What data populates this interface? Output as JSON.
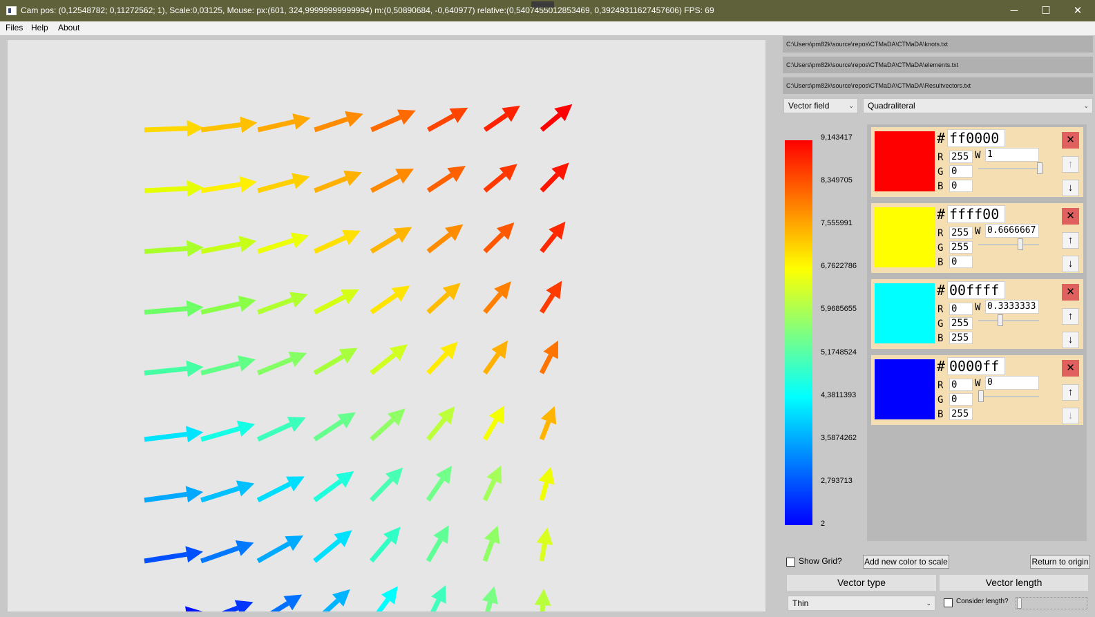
{
  "window": {
    "title": "Cam pos: (0,12548782; 0,11272562; 1), Scale:0,03125, Mouse: px:(601, 324,99999999999994) m:(0,50890684, -0,640977) relative:(0,5407455012853469, 0,39249311627457606) FPS: 69",
    "minimize_glyph": "─",
    "maximize_glyph": "☐",
    "close_glyph": "✕"
  },
  "menu": {
    "files": "Files",
    "help": "Help",
    "about": "About"
  },
  "paths": {
    "knots": "C:\\Users\\pm82k\\source\\repos\\CTMaDA\\CTMaDA\\knots.txt",
    "elements": "C:\\Users\\pm82k\\source\\repos\\CTMaDA\\CTMaDA\\elements.txt",
    "results": "C:\\Users\\pm82k\\source\\repos\\CTMaDA\\CTMaDA\\Resultvectors.txt"
  },
  "display_mode": {
    "selected": "Vector field"
  },
  "element_type": {
    "selected": "Quadraliteral"
  },
  "scale_ticks": [
    "9,143417",
    "8,349705",
    "7,555991",
    "6,7622786",
    "5,9685655",
    "5,1748524",
    "4,3811393",
    "3,5874262",
    "2,793713",
    "2"
  ],
  "color_entries": [
    {
      "hex": "ff0000",
      "color": "#ff0000",
      "r": "255",
      "g": "0",
      "b": "0",
      "w": "1",
      "w_value": 1.0,
      "up_enabled": false,
      "down_enabled": true
    },
    {
      "hex": "ffff00",
      "color": "#ffff00",
      "r": "255",
      "g": "255",
      "b": "0",
      "w": "0.6666667",
      "w_value": 0.6666667,
      "up_enabled": true,
      "down_enabled": true
    },
    {
      "hex": "00ffff",
      "color": "#00ffff",
      "r": "0",
      "g": "255",
      "b": "255",
      "w": "0.3333333",
      "w_value": 0.3333333,
      "up_enabled": true,
      "down_enabled": true
    },
    {
      "hex": "0000ff",
      "color": "#0000ff",
      "r": "0",
      "g": "0",
      "b": "255",
      "w": "0",
      "w_value": 0.0,
      "up_enabled": true,
      "down_enabled": false
    }
  ],
  "labels": {
    "hash": "#",
    "r": "R",
    "g": "G",
    "b": "B",
    "w": "W",
    "delete_glyph": "✕",
    "up_glyph": "↑",
    "down_glyph": "↓",
    "show_grid": "Show Grid?",
    "add_color": "Add new color to scale",
    "return_origin": "Return to origin",
    "vector_type_header": "Vector type",
    "vector_length_header": "Vector length",
    "consider_length": "Consider length?"
  },
  "vector_type": {
    "selected": "Thin"
  },
  "show_grid_checked": false,
  "consider_length_checked": false,
  "vector_length_slider": 0.0,
  "vector_field": {
    "rows": 9,
    "cols": 8,
    "colors": [
      [
        "#ffd800",
        "#ffc000",
        "#ffa800",
        "#ff8c00",
        "#ff6a00",
        "#ff4400",
        "#ff2200",
        "#ff0000"
      ],
      [
        "#e6ff00",
        "#fff000",
        "#ffd000",
        "#ffb000",
        "#ff8a00",
        "#ff6000",
        "#ff3800",
        "#ff1400"
      ],
      [
        "#a8ff2a",
        "#c8ff18",
        "#ecff08",
        "#ffe000",
        "#ffb400",
        "#ff8c00",
        "#ff5800",
        "#ff2800"
      ],
      [
        "#6cff66",
        "#8aff48",
        "#b0ff30",
        "#d4ff14",
        "#ffe400",
        "#ffbc00",
        "#ff8000",
        "#ff3c00"
      ],
      [
        "#44ffa4",
        "#62ff86",
        "#84ff64",
        "#a8ff3c",
        "#d0ff20",
        "#ffec00",
        "#ffb000",
        "#ff7400"
      ],
      [
        "#00e4ff",
        "#14ffe6",
        "#3cffbc",
        "#66ff8e",
        "#90ff66",
        "#bcff3a",
        "#f4ff00",
        "#ffb400"
      ],
      [
        "#00a8ff",
        "#00c0ff",
        "#00deff",
        "#20ffdc",
        "#48ffb4",
        "#72ff8a",
        "#a4ff5a",
        "#f0ff00"
      ],
      [
        "#0050ff",
        "#0078ff",
        "#00aaff",
        "#00e0ff",
        "#30ffc6",
        "#60ff96",
        "#90ff66",
        "#d8ff20"
      ],
      [
        "#0010ff",
        "#0034ff",
        "#0070ff",
        "#00b4ff",
        "#00ffff",
        "#40ffbc",
        "#78ff84",
        "#b8ff3c"
      ]
    ]
  }
}
